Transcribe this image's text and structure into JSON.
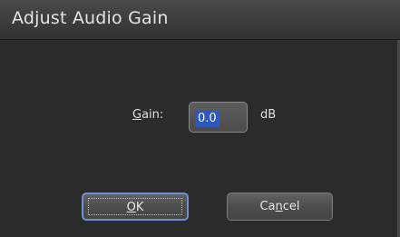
{
  "dialog": {
    "title": "Adjust Audio Gain"
  },
  "gain": {
    "label_mnemonic": "G",
    "label_rest": "ain:",
    "value": "0.0",
    "unit": "dB"
  },
  "buttons": {
    "ok_mnemonic": "O",
    "ok_rest": "K",
    "cancel_pre": "Ca",
    "cancel_mnemonic": "n",
    "cancel_post": "cel"
  }
}
